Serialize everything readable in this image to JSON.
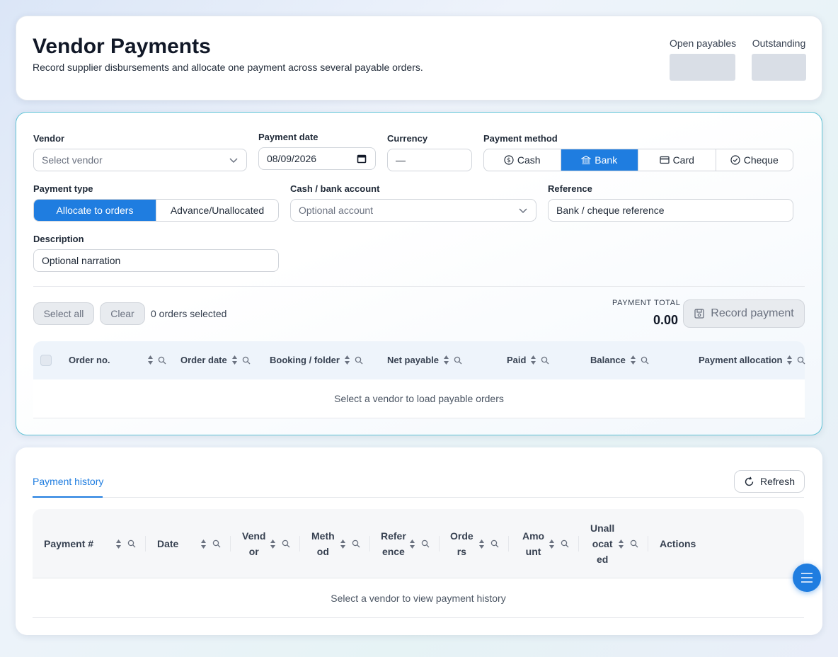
{
  "header": {
    "title": "Vendor Payments",
    "subtitle": "Record supplier disbursements and allocate one payment across several payable orders.",
    "stats": [
      {
        "label": "Open payables"
      },
      {
        "label": "Outstanding"
      }
    ]
  },
  "form": {
    "vendor": {
      "label": "Vendor",
      "placeholder": "Select vendor"
    },
    "payment_date": {
      "label": "Payment date",
      "value": "08/09/2026"
    },
    "currency": {
      "label": "Currency",
      "value": "—"
    },
    "payment_method": {
      "label": "Payment method",
      "options": [
        {
          "label": "Cash",
          "icon": "dollar-circle-icon",
          "active": false
        },
        {
          "label": "Bank",
          "icon": "bank-icon",
          "active": true
        },
        {
          "label": "Card",
          "icon": "credit-card-icon",
          "active": false
        },
        {
          "label": "Cheque",
          "icon": "check-circle-icon",
          "active": false
        }
      ]
    },
    "payment_type": {
      "label": "Payment type",
      "options": [
        {
          "label": "Allocate to orders",
          "active": true
        },
        {
          "label": "Advance/Unallocated",
          "active": false
        }
      ]
    },
    "account": {
      "label": "Cash / bank account",
      "placeholder": "Optional account"
    },
    "reference": {
      "label": "Reference",
      "placeholder": "Bank / cheque reference"
    },
    "description": {
      "label": "Description",
      "placeholder": "Optional narration"
    }
  },
  "toolbar": {
    "select_all": "Select all",
    "clear": "Clear",
    "orders_selected": "0 orders selected",
    "payment_total_label": "PAYMENT TOTAL",
    "payment_total_value": "0.00",
    "record_payment": "Record payment"
  },
  "orders_table": {
    "columns": [
      "Order no.",
      "Order date",
      "Booking / folder",
      "Net payable",
      "Paid",
      "Balance",
      "Payment allocation"
    ],
    "empty_message": "Select a vendor to load payable orders"
  },
  "history": {
    "tab_label": "Payment history",
    "refresh_label": "Refresh",
    "columns": [
      "Payment #",
      "Date",
      "Vend\nor",
      "Meth\nod",
      "Refer\nence",
      "Orde\nrs",
      "Amo\nunt",
      "Unall\nocat\ned",
      "Actions"
    ],
    "empty_message": "Select a vendor to view payment history"
  },
  "colors": {
    "accent": "#1f7de0",
    "form_border": "#5fc3d6"
  }
}
